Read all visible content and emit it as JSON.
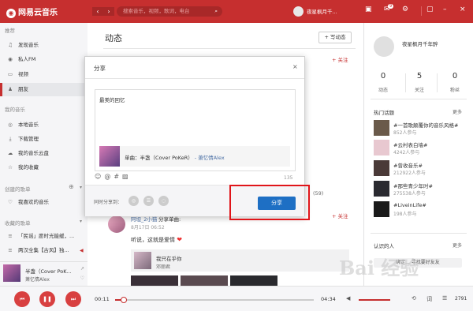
{
  "app": {
    "name": "网易云音乐"
  },
  "topbar": {
    "back_icon": "‹",
    "forward_icon": "›",
    "search_placeholder": "搜索音乐，视频，歌词，电台",
    "user_name": "夜星枫月千...",
    "badge_count": "9",
    "accent_color": "#c62f2f"
  },
  "sidebar": {
    "section_recommend": "推荐",
    "recommend_items": [
      {
        "label": "发现音乐",
        "icon": "♫"
      },
      {
        "label": "私人FM",
        "icon": "◉"
      },
      {
        "label": "视频",
        "icon": "▭"
      },
      {
        "label": "朋友",
        "icon": "♟"
      }
    ],
    "section_my_music": "我的音乐",
    "my_music_items": [
      {
        "label": "本地音乐",
        "icon": "◎"
      },
      {
        "label": "下载管理",
        "icon": "⤓"
      },
      {
        "label": "我的音乐云盘",
        "icon": "☁"
      },
      {
        "label": "我的收藏",
        "icon": "☆"
      }
    ],
    "section_created": "创建的歌单",
    "created_items": [
      {
        "label": "我喜欢的音乐",
        "icon": "♡"
      }
    ],
    "section_collected": "收藏的歌单",
    "collected_items": [
      {
        "label": "「民谣」愿时光能缓，...",
        "icon": "≡"
      },
      {
        "label": "两汉全集【古风】独...",
        "icon": "≡"
      }
    ]
  },
  "now_playing": {
    "title": "半盏（Cover PoK...",
    "artist": "萧忆情Alex"
  },
  "main": {
    "title": "动态",
    "write_button": "+ 写动态",
    "follow_label": "+ 关注",
    "comment_count": "(59)",
    "post": {
      "user": "阿坦_2小猫",
      "action": "分享单曲:",
      "time": "8月17日 06:52",
      "text": "听说，这就是爱情",
      "song_title": "我只在乎你",
      "song_artist": "邓丽君"
    }
  },
  "dialog": {
    "title": "分享",
    "close_icon": "×",
    "text": "最美的回忆",
    "song_prefix": "单曲：",
    "song_title": "半盏（Cover PoKeR）",
    "song_artist": "- 萧忆情Alex",
    "char_count": "135",
    "share_to_label": "同时分享到：",
    "share_button": "分享"
  },
  "right": {
    "user_name": "夜星枫月千年醉",
    "stats": [
      {
        "num": "0",
        "label": "动态"
      },
      {
        "num": "5",
        "label": "关注"
      },
      {
        "num": "0",
        "label": "粉丝"
      }
    ],
    "hot_topics_title": "热门话题",
    "more_label": "更多",
    "topics": [
      {
        "title": "#一首歌颠覆你的音乐风格#",
        "count": "852人参与",
        "color": "#6a5a4a"
      },
      {
        "title": "#云村表白墙#",
        "count": "4242人参与",
        "color": "#e8c8d0"
      },
      {
        "title": "#曾收音乐#",
        "count": "212922人参与",
        "color": "#4a3a38"
      },
      {
        "title": "#那些青少年时#",
        "count": "275538人参与",
        "color": "#2a2a30"
      },
      {
        "title": "#LiveinLife#",
        "count": "198人参与",
        "color": "#1a1a1a"
      }
    ],
    "recommend_people_title": "认识的人",
    "find_button": "绑定... 寻找要好友友"
  },
  "playbar": {
    "current_time": "00:11",
    "total_time": "04:34",
    "progress": 0.04,
    "volume": 1.0,
    "count": "2791"
  },
  "watermark": "Bai 经验"
}
